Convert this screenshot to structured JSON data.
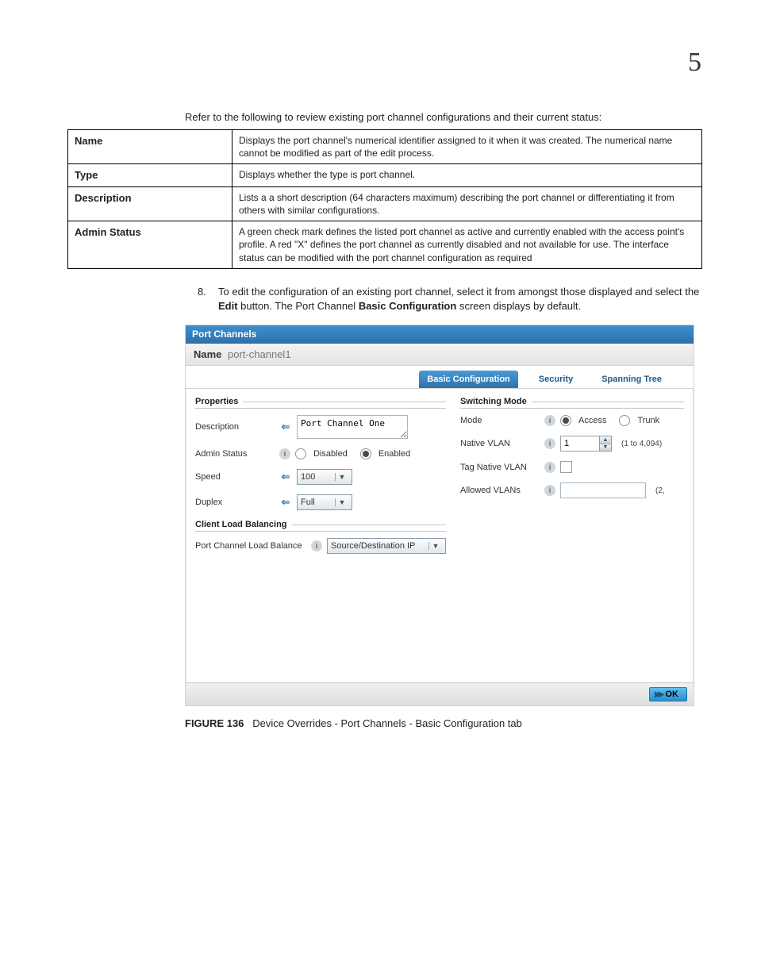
{
  "chapter_number": "5",
  "intro": "Refer to the following to review existing port channel configurations and their current status:",
  "desc_table": [
    {
      "label": "Name",
      "text": "Displays the port channel's numerical identifier assigned to it when it was created. The numerical name cannot be modified as part of the edit process."
    },
    {
      "label": "Type",
      "text": "Displays whether the type is port channel."
    },
    {
      "label": "Description",
      "text": "Lists a a short description (64 characters maximum) describing the port channel or differentiating it from others with similar configurations."
    },
    {
      "label": "Admin Status",
      "text": "A green check mark defines the listed port channel as active and currently enabled with the access point's profile. A red \"X\" defines the port channel as currently disabled and not available for use. The interface status can be modified with the port channel configuration as required"
    }
  ],
  "step": {
    "number": "8.",
    "pre": "To edit the configuration of an existing port channel, select it from amongst those displayed and select the ",
    "bold1": "Edit",
    "mid": " button. The Port Channel ",
    "bold2": "Basic Configuration",
    "post": " screen displays by default."
  },
  "shot": {
    "header": "Port Channels",
    "name_label": "Name",
    "name_value": "port-channel1",
    "tabs": {
      "basic": "Basic Configuration",
      "security": "Security",
      "spanning": "Spanning Tree"
    },
    "sections": {
      "properties": "Properties",
      "switching": "Switching Mode",
      "clb": "Client Load Balancing"
    },
    "properties": {
      "description_label": "Description",
      "description_value": "Port Channel One",
      "admin_label": "Admin Status",
      "admin_disabled": "Disabled",
      "admin_enabled": "Enabled",
      "speed_label": "Speed",
      "speed_value": "100",
      "duplex_label": "Duplex",
      "duplex_value": "Full",
      "pclb_label": "Port Channel Load Balance",
      "pclb_value": "Source/Destination IP"
    },
    "switching": {
      "mode_label": "Mode",
      "mode_access": "Access",
      "mode_trunk": "Trunk",
      "native_label": "Native VLAN",
      "native_value": "1",
      "native_range": "(1 to 4,094)",
      "tag_label": "Tag Native VLAN",
      "allowed_label": "Allowed VLANs",
      "allowed_value": "",
      "allowed_note": "(2,"
    },
    "ok_label": "OK"
  },
  "caption": {
    "label": "FIGURE 136",
    "text": "Device Overrides - Port Channels - Basic Configuration tab"
  }
}
